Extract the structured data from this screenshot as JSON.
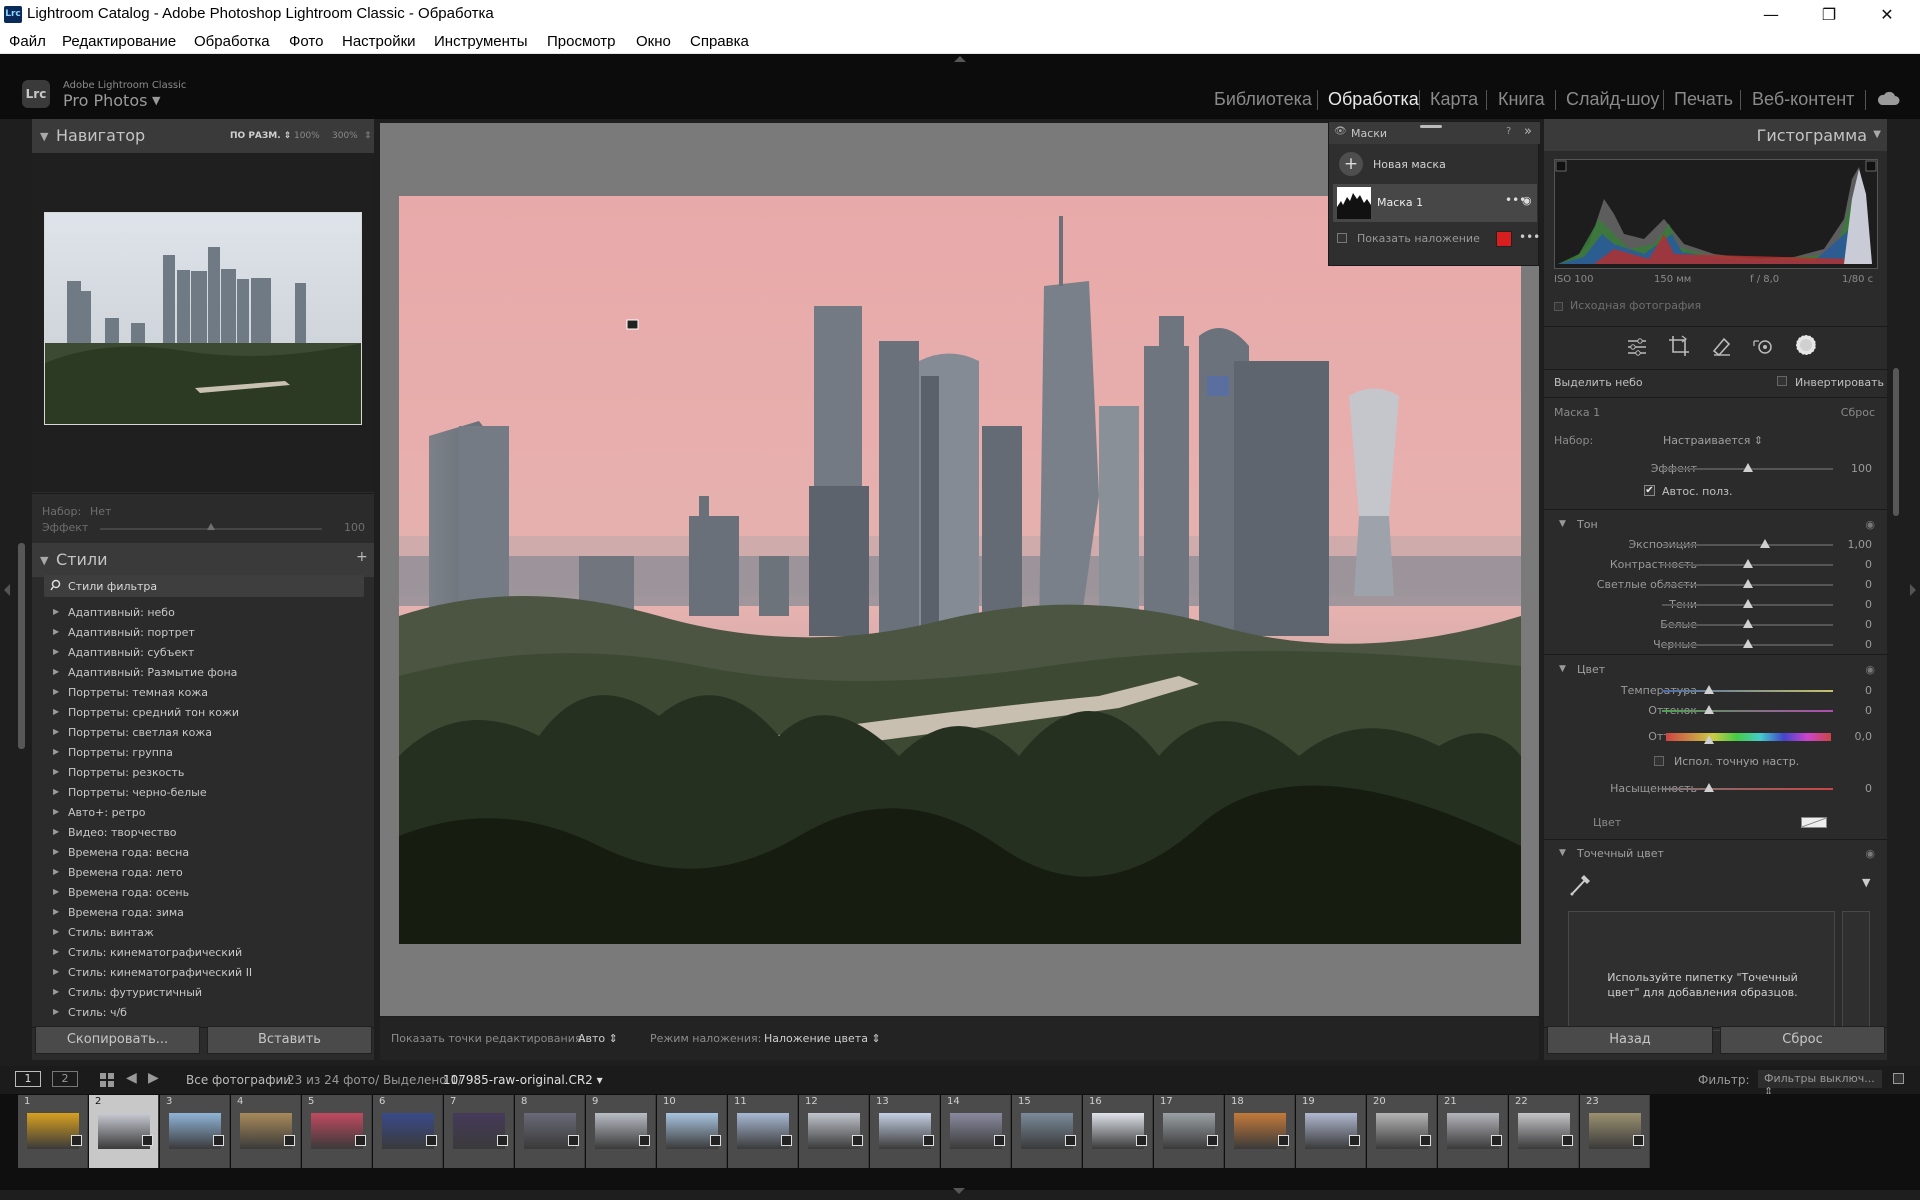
{
  "window": {
    "title": "Lightroom Catalog - Adobe Photoshop Lightroom Classic - Обработка",
    "app_icon": "Lrc",
    "minimize": "—",
    "maximize": "❐",
    "close": "✕"
  },
  "menu": [
    "Файл",
    "Редактирование",
    "Обработка",
    "Фото",
    "Настройки",
    "Инструменты",
    "Просмотр",
    "Окно",
    "Справка"
  ],
  "identity": {
    "logo": "Lrc",
    "small": "Adobe Lightroom Classic",
    "name": "Pro Photos",
    "arrow": "▼"
  },
  "modules": {
    "items": [
      "Библиотека",
      "Обработка",
      "Карта",
      "Книга",
      "Слайд-шоу",
      "Печать",
      "Веб-контент"
    ],
    "active": "Обработка",
    "cloud_icon": "cloud-icon"
  },
  "navigator": {
    "title": "Навигатор",
    "zoom_fit": "ПО РАЗМ. ⇕",
    "zoom_100": "100%",
    "zoom_300": "300%",
    "zoom_menu": "⇕",
    "preset_label": "Набор:",
    "preset_value": "Нет",
    "effect_label": "Эффект",
    "effect_value": "100",
    "effect_level": 0.5
  },
  "styles": {
    "title": "Стили",
    "add": "+",
    "filter_placeholder": "Стили фильтра",
    "items": [
      "Адаптивный: небо",
      "Адаптивный: портрет",
      "Адаптивный: субъект",
      "Адаптивный: Размытие фона",
      "Портреты: темная кожа",
      "Портреты: средний тон кожи",
      "Портреты: светлая кожа",
      "Портреты: группа",
      "Портреты: резкость",
      "Портреты: черно-белые",
      "Авто+: ретро",
      "Видео: творчество",
      "Времена года: весна",
      "Времена года: лето",
      "Времена года: осень",
      "Времена года: зима",
      "Стиль: винтаж",
      "Стиль: кинематографический",
      "Стиль: кинематографический II",
      "Стиль: футуристичный",
      "Стиль: ч/б"
    ]
  },
  "left_buttons": {
    "copy": "Скопировать...",
    "paste": "Вставить"
  },
  "toolbar": {
    "show_points_label": "Показать точки редактирования:",
    "show_points_value": "Авто ⇕",
    "overlay_mode_label": "Режим наложения:",
    "overlay_mode_value": "Наложение цвета ⇕"
  },
  "masks": {
    "title": "Маски",
    "help": "?",
    "collapse": "»",
    "new_mask": "Новая маска",
    "mask1": "Маска 1",
    "more": "•••",
    "show_overlay": "Показать наложение",
    "overlay_color": "#d81f1f"
  },
  "histogram": {
    "title": "Гистограмма",
    "iso": "ISO 100",
    "focal": "150 мм",
    "aperture": "f / 8,0",
    "shutter": "1/80 с",
    "original": "Исходная фотография"
  },
  "mask_panel": {
    "select_sky": "Выделить небо",
    "invert": "Инвертировать",
    "mask_name": "Маска 1",
    "reset": "Сброс",
    "preset_label": "Набор:",
    "preset_value": "Настраивается ⇕",
    "effect_label": "Эффект",
    "effect_value": "100",
    "effect_level": 0.5,
    "auto_mask": "Автос. полз.",
    "auto_mask_checked": "✔"
  },
  "tone": {
    "title": "Тон",
    "rows": [
      {
        "label": "Экспозиция",
        "value": "1,00",
        "level": 0.6
      },
      {
        "label": "Контрастность",
        "value": "0",
        "level": 0.5
      },
      {
        "label": "Светлые области",
        "value": "0",
        "level": 0.5
      },
      {
        "label": "Тени",
        "value": "0",
        "level": 0.5
      },
      {
        "label": "Белые",
        "value": "0",
        "level": 0.5
      },
      {
        "label": "Черные",
        "value": "0",
        "level": 0.5
      }
    ]
  },
  "color": {
    "title": "Цвет",
    "temperature_label": "Температура",
    "temperature_value": "0",
    "tint_label": "Оттенок",
    "tint_value": "0",
    "hue_label": "Оттенок",
    "hue_value": "0,0",
    "fine_label": "Испол. точную настр.",
    "saturation_label": "Насыщенность",
    "saturation_value": "0",
    "color_label": "Цвет"
  },
  "point_color": {
    "title": "Точечный цвет",
    "hint": "Используйте пипетку \"Точечный цвет\" для добавления образцов."
  },
  "right_buttons": {
    "back": "Назад",
    "reset": "Сброс"
  },
  "filmbar": {
    "screen1": "1",
    "screen2": "2",
    "source": "Все фотографии",
    "count": "23 из 24 фото/ Выделено 1/",
    "file": "107985-raw-original.CR2 ▾",
    "filter_label": "Фильтр:",
    "filter_value": "Фильтры выключ... ⇕"
  },
  "filmstrip": {
    "numbers": [
      "1",
      "2",
      "3",
      "4",
      "5",
      "6",
      "7",
      "8",
      "9",
      "10",
      "11",
      "12",
      "13",
      "14",
      "15",
      "16",
      "17",
      "18",
      "19",
      "20",
      "21",
      "22",
      "23"
    ],
    "selected": "2"
  }
}
